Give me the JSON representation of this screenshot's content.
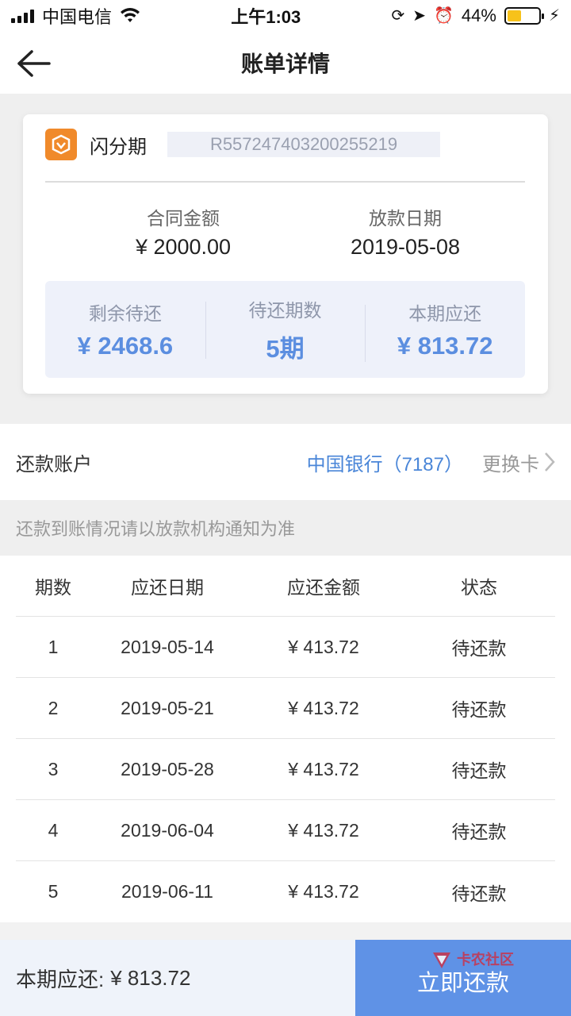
{
  "status_bar": {
    "carrier": "中国电信",
    "time": "上午1:03",
    "battery_percent": "44%",
    "battery_level": 0.44
  },
  "nav": {
    "title": "账单详情"
  },
  "loan_card": {
    "product_name": "闪分期",
    "order_no": "R557247403200255219",
    "contract_amount_label": "合同金额",
    "contract_amount": "¥ 2000.00",
    "loan_date_label": "放款日期",
    "loan_date": "2019-05-08",
    "summary": [
      {
        "label": "剩余待还",
        "value": "¥ 2468.6"
      },
      {
        "label": "待还期数",
        "value": "5期"
      },
      {
        "label": "本期应还",
        "value": "¥ 813.72"
      }
    ]
  },
  "account": {
    "label": "还款账户",
    "bank": "中国银行（7187）",
    "change_label": "更换卡"
  },
  "notice": "还款到账情况请以放款机构通知为准",
  "table": {
    "headers": [
      "期数",
      "应还日期",
      "应还金额",
      "状态"
    ],
    "rows": [
      [
        "1",
        "2019-05-14",
        "¥ 413.72",
        "待还款"
      ],
      [
        "2",
        "2019-05-21",
        "¥ 413.72",
        "待还款"
      ],
      [
        "3",
        "2019-05-28",
        "¥ 413.72",
        "待还款"
      ],
      [
        "4",
        "2019-06-04",
        "¥ 413.72",
        "待还款"
      ],
      [
        "5",
        "2019-06-11",
        "¥ 413.72",
        "待还款"
      ]
    ]
  },
  "bottom": {
    "due_label": "本期应还:",
    "due_amount": "¥ 813.72",
    "pay_button": "立即还款",
    "watermark": "卡农社区"
  },
  "colors": {
    "accent": "#5f92e6",
    "logo": "#f08a2b",
    "bank_text": "#4a86d8"
  }
}
